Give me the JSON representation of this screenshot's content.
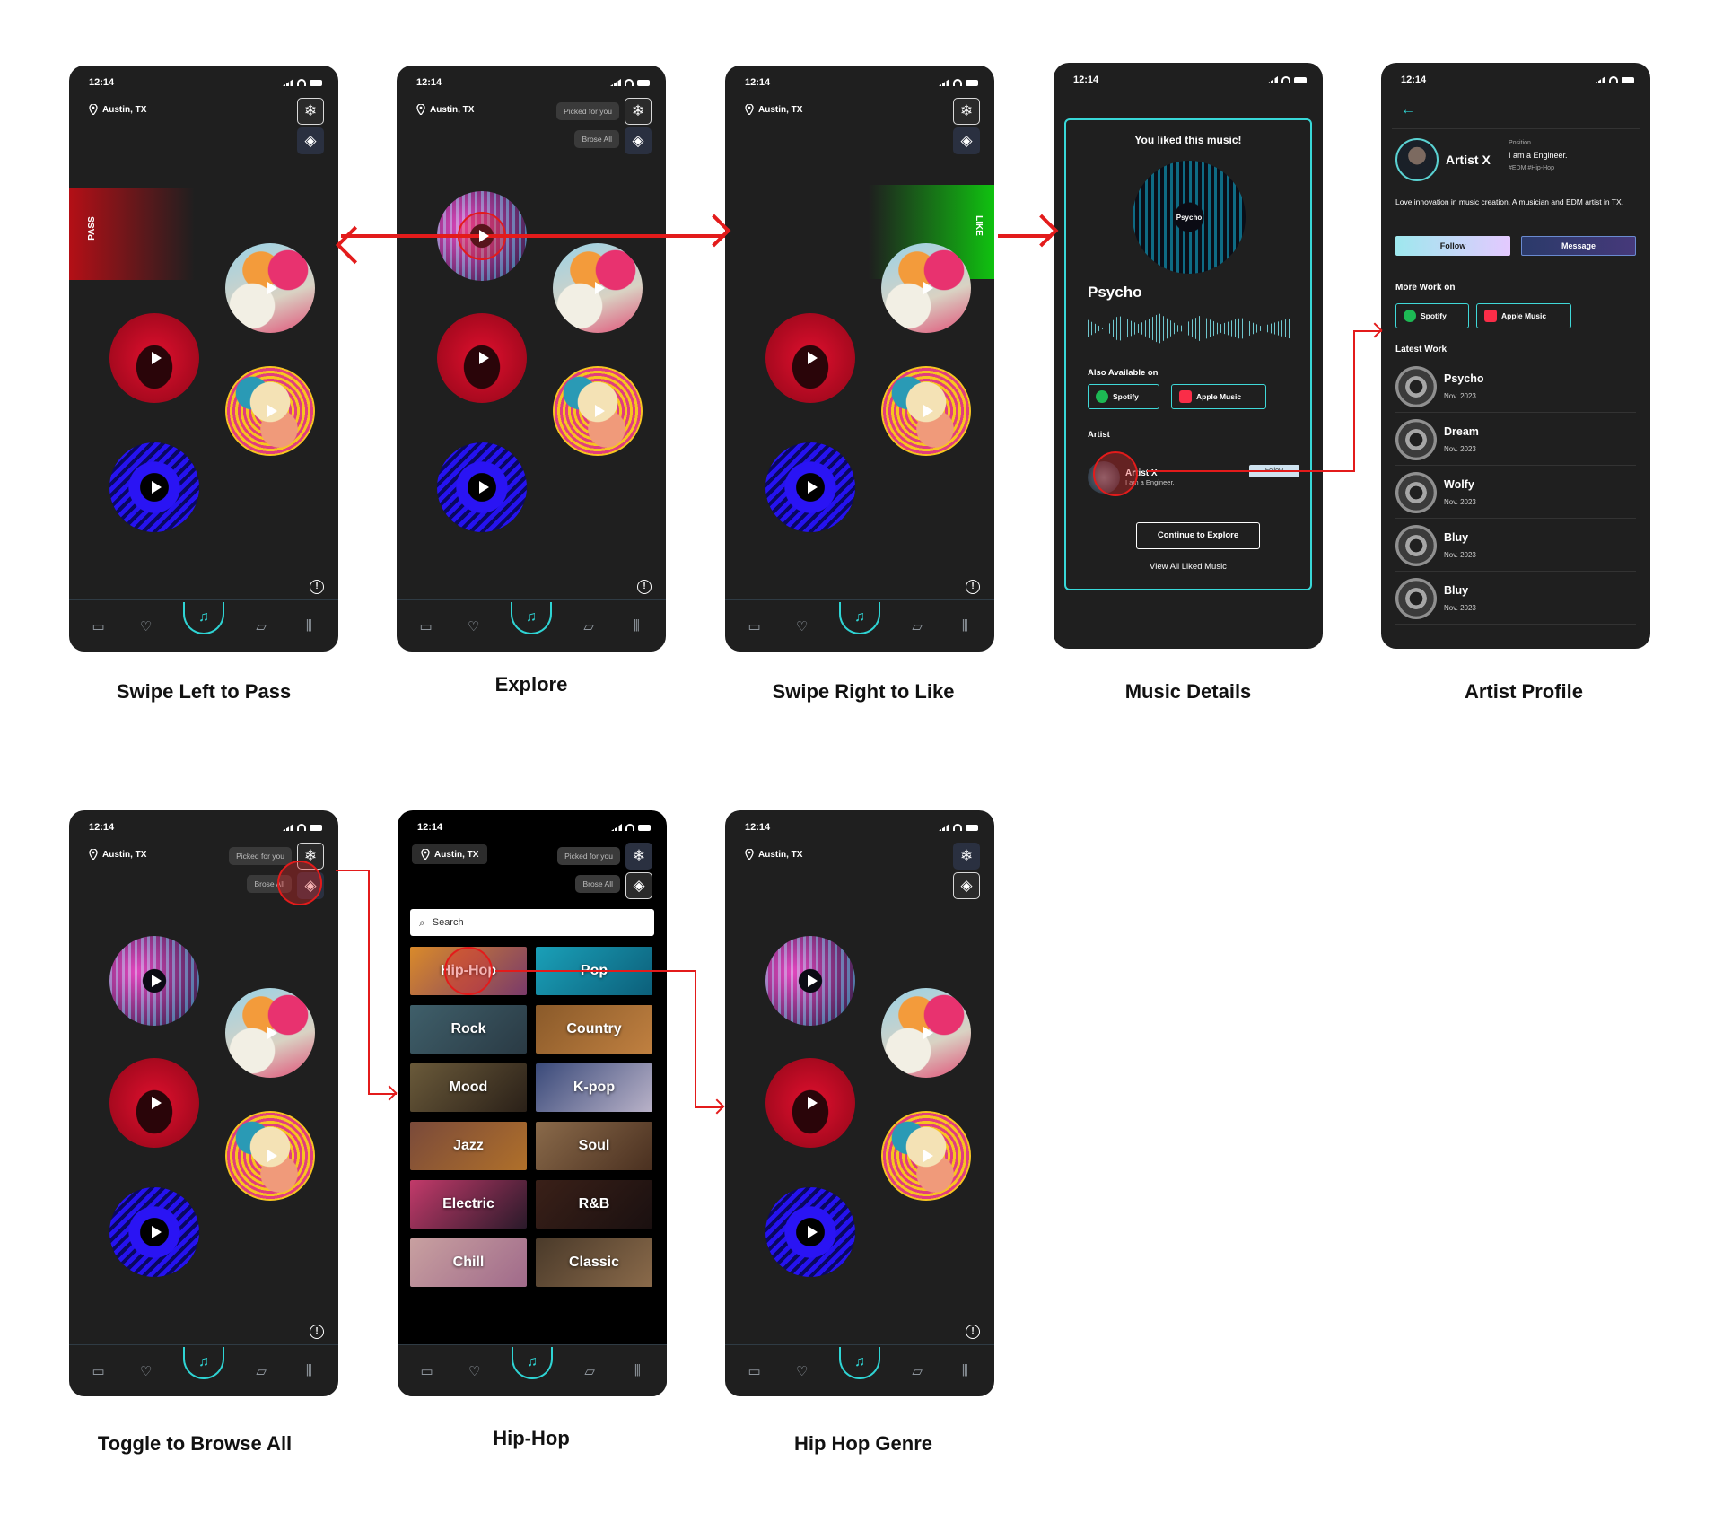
{
  "status": {
    "time": "12:14"
  },
  "location": "Austin, TX",
  "tags": {
    "picked": "Picked for you",
    "browse": "Brose All"
  },
  "overlays": {
    "pass": "PASS",
    "like": "LIKE"
  },
  "captions": {
    "swipe_left": "Swipe Left to Pass",
    "explore": "Explore",
    "swipe_right": "Swipe Right to Like",
    "music_details": "Music Details",
    "artist_profile": "Artist Profile",
    "toggle_browse": "Toggle to Browse All",
    "hiphop": "Hip-Hop",
    "hiphop_genre": "Hip Hop Genre"
  },
  "icons": {
    "pin": "location-pin-icon",
    "snow": "snowflake-icon",
    "layers": "layers-icon",
    "info": "info-icon",
    "nav": [
      "ticket-icon",
      "heart-icon",
      "music-note-icon",
      "chat-icon",
      "library-icon"
    ]
  },
  "music_details": {
    "liked_title": "You liked this music!",
    "disc_label": "Psycho",
    "song": "Psycho",
    "also_available": "Also Available on",
    "spotify": "Spotify",
    "apple": "Apple Music",
    "artist_heading": "Artist",
    "artist_name": "Artist X",
    "artist_sub": "I am a Engineer.",
    "follow": "Follow",
    "continue": "Continue to Explore",
    "view_all": "View All Liked Music"
  },
  "artist_profile": {
    "name": "Artist X",
    "position_label": "Position",
    "position": "I am a Engineer.",
    "tags": "#EDM  #Hip-Hop",
    "bio": "Love innovation in music creation. A musician and EDM artist in TX.",
    "follow": "Follow",
    "message": "Message",
    "more_work": "More Work on",
    "spotify": "Spotify",
    "apple": "Apple Music",
    "latest_work": "Latest Work",
    "works": [
      {
        "title": "Psycho",
        "date": "Nov. 2023"
      },
      {
        "title": "Dream",
        "date": "Nov. 2023"
      },
      {
        "title": "Wolfy",
        "date": "Nov. 2023"
      },
      {
        "title": "Bluy",
        "date": "Nov. 2023"
      },
      {
        "title": "Bluy",
        "date": "Nov. 2023"
      }
    ]
  },
  "genres": {
    "search_placeholder": "Search",
    "items": [
      "Hip-Hop",
      "Pop",
      "Rock",
      "Country",
      "Mood",
      "K-pop",
      "Jazz",
      "Soul",
      "Electric",
      "R&B",
      "Chill",
      "Classic"
    ]
  },
  "colors": {
    "accent": "#2fd4d4",
    "arrow": "#e31b1b",
    "pass": "#b40f16",
    "like": "#10c210"
  }
}
